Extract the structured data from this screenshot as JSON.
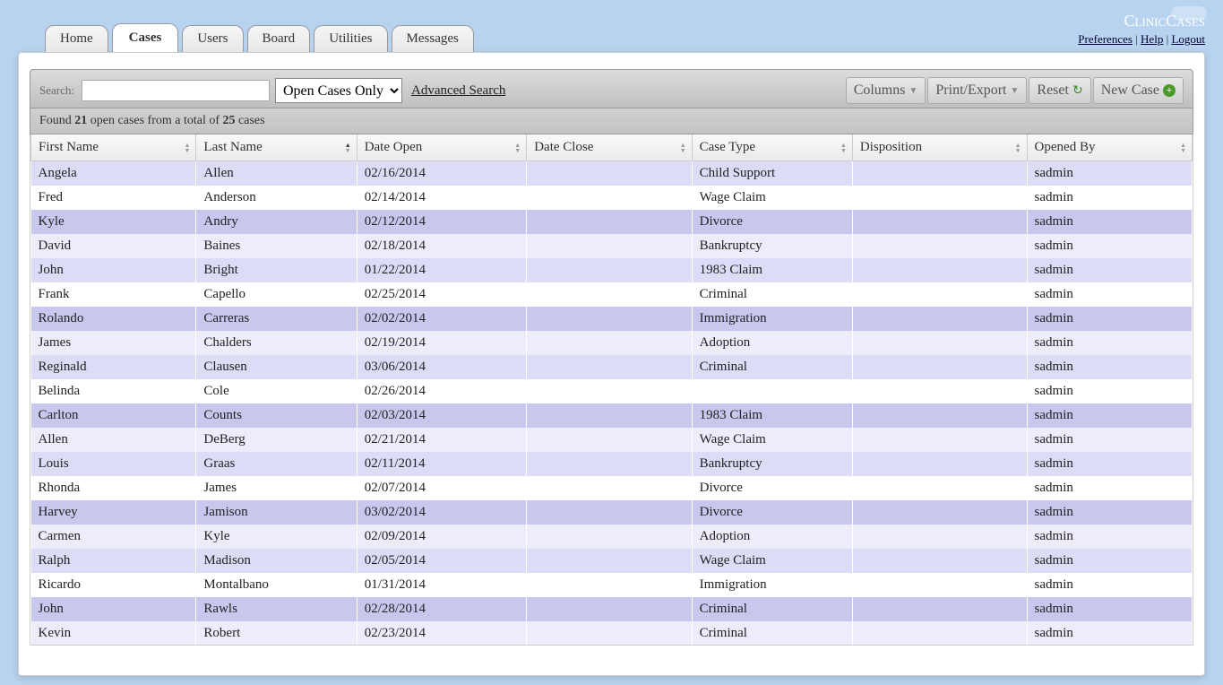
{
  "header": {
    "logo_a": "Clinic",
    "logo_b": "Cases",
    "links": {
      "prefs": "Preferences",
      "help": "Help",
      "logout": "Logout"
    }
  },
  "tabs": [
    {
      "label": "Home",
      "active": false
    },
    {
      "label": "Cases",
      "active": true
    },
    {
      "label": "Users",
      "active": false
    },
    {
      "label": "Board",
      "active": false
    },
    {
      "label": "Utilities",
      "active": false
    },
    {
      "label": "Messages",
      "active": false
    }
  ],
  "toolbar": {
    "search_label": "Search:",
    "filter_selected": "Open Cases Only",
    "adv_search": "Advanced Search",
    "columns": "Columns",
    "print_export": "Print/Export",
    "reset": "Reset",
    "new_case": "New Case"
  },
  "results": {
    "prefix": "Found ",
    "count": "21",
    "mid": " open cases from a total of ",
    "total": "25",
    "suffix": " cases"
  },
  "columns": [
    {
      "label": "First Name",
      "width": "180"
    },
    {
      "label": "Last Name",
      "width": "175",
      "sorted": "asc"
    },
    {
      "label": "Date Open",
      "width": "185"
    },
    {
      "label": "Date Close",
      "width": "180"
    },
    {
      "label": "Case Type",
      "width": "175"
    },
    {
      "label": "Disposition",
      "width": "190"
    },
    {
      "label": "Opened By",
      "width": "180"
    }
  ],
  "rows": [
    {
      "first": "Angela",
      "last": "Allen",
      "open": "02/16/2014",
      "close": "",
      "type": "Child Support",
      "disp": "",
      "by": "sadmin"
    },
    {
      "first": "Fred",
      "last": "Anderson",
      "open": "02/14/2014",
      "close": "",
      "type": "Wage Claim",
      "disp": "",
      "by": "sadmin"
    },
    {
      "first": "Kyle",
      "last": "Andry",
      "open": "02/12/2014",
      "close": "",
      "type": "Divorce",
      "disp": "",
      "by": "sadmin"
    },
    {
      "first": "David",
      "last": "Baines",
      "open": "02/18/2014",
      "close": "",
      "type": "Bankruptcy",
      "disp": "",
      "by": "sadmin"
    },
    {
      "first": "John",
      "last": "Bright",
      "open": "01/22/2014",
      "close": "",
      "type": "1983 Claim",
      "disp": "",
      "by": "sadmin"
    },
    {
      "first": "Frank",
      "last": "Capello",
      "open": "02/25/2014",
      "close": "",
      "type": "Criminal",
      "disp": "",
      "by": "sadmin"
    },
    {
      "first": "Rolando",
      "last": "Carreras",
      "open": "02/02/2014",
      "close": "",
      "type": "Immigration",
      "disp": "",
      "by": "sadmin"
    },
    {
      "first": "James",
      "last": "Chalders",
      "open": "02/19/2014",
      "close": "",
      "type": "Adoption",
      "disp": "",
      "by": "sadmin"
    },
    {
      "first": "Reginald",
      "last": "Clausen",
      "open": "03/06/2014",
      "close": "",
      "type": "Criminal",
      "disp": "",
      "by": "sadmin"
    },
    {
      "first": "Belinda",
      "last": "Cole",
      "open": "02/26/2014",
      "close": "",
      "type": "",
      "disp": "",
      "by": "sadmin"
    },
    {
      "first": "Carlton",
      "last": "Counts",
      "open": "02/03/2014",
      "close": "",
      "type": "1983 Claim",
      "disp": "",
      "by": "sadmin"
    },
    {
      "first": "Allen",
      "last": "DeBerg",
      "open": "02/21/2014",
      "close": "",
      "type": "Wage Claim",
      "disp": "",
      "by": "sadmin"
    },
    {
      "first": "Louis",
      "last": "Graas",
      "open": "02/11/2014",
      "close": "",
      "type": "Bankruptcy",
      "disp": "",
      "by": "sadmin"
    },
    {
      "first": "Rhonda",
      "last": "James",
      "open": "02/07/2014",
      "close": "",
      "type": "Divorce",
      "disp": "",
      "by": "sadmin"
    },
    {
      "first": "Harvey",
      "last": "Jamison",
      "open": "03/02/2014",
      "close": "",
      "type": "Divorce",
      "disp": "",
      "by": "sadmin"
    },
    {
      "first": "Carmen",
      "last": "Kyle",
      "open": "02/09/2014",
      "close": "",
      "type": "Adoption",
      "disp": "",
      "by": "sadmin"
    },
    {
      "first": "Ralph",
      "last": "Madison",
      "open": "02/05/2014",
      "close": "",
      "type": "Wage Claim",
      "disp": "",
      "by": "sadmin"
    },
    {
      "first": "Ricardo",
      "last": "Montalbano",
      "open": "01/31/2014",
      "close": "",
      "type": "Immigration",
      "disp": "",
      "by": "sadmin"
    },
    {
      "first": "John",
      "last": "Rawls",
      "open": "02/28/2014",
      "close": "",
      "type": "Criminal",
      "disp": "",
      "by": "sadmin"
    },
    {
      "first": "Kevin",
      "last": "Robert",
      "open": "02/23/2014",
      "close": "",
      "type": "Criminal",
      "disp": "",
      "by": "sadmin"
    }
  ]
}
